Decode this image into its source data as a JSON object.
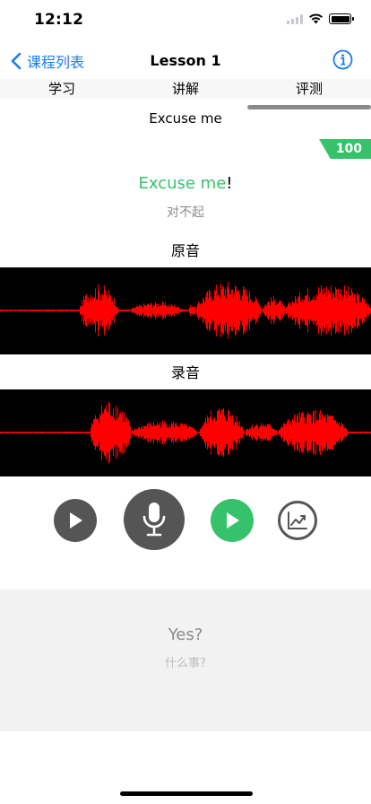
{
  "status": {
    "time": "12:12"
  },
  "nav": {
    "back_label": "课程列表",
    "title": "Lesson 1"
  },
  "tabs": [
    {
      "label": "学习"
    },
    {
      "label": "讲解"
    },
    {
      "label": "评测"
    }
  ],
  "current": {
    "phrase": "Excuse me",
    "score": "100",
    "sentence_matched": "Excuse me",
    "sentence_rest": "!",
    "translation": "对不起"
  },
  "waves": {
    "original_label": "原音",
    "recording_label": "录音"
  },
  "next": {
    "phrase": "Yes?",
    "translation": "什么事?"
  },
  "colors": {
    "accent": "#1a7cf0",
    "correct": "#35c26b",
    "waveform": "#ff0000",
    "button_dark": "#555555"
  }
}
